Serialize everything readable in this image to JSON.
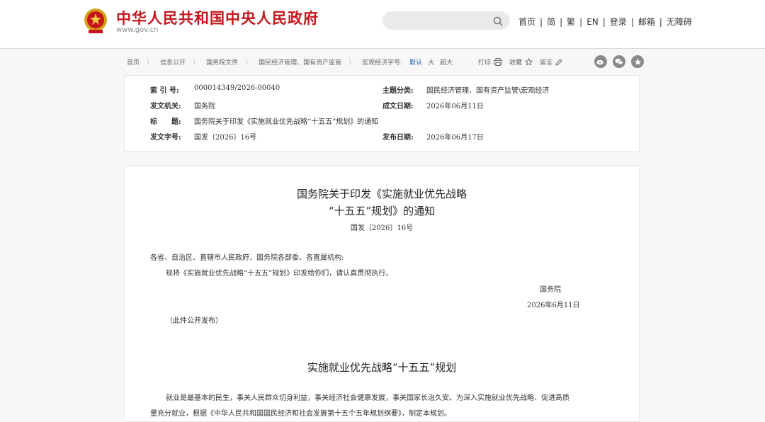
{
  "header": {
    "site_title": "中华人民共和国中央人民政府",
    "site_domain": "www.gov.cn",
    "search_placeholder": "",
    "links": [
      "首页",
      "简",
      "繁",
      "EN",
      "登录",
      "邮箱",
      "无障碍"
    ],
    "separator": "|"
  },
  "breadcrumb": {
    "items": [
      "首页",
      "信息公开",
      "国务院文件",
      "国民经济管理、国有资产监管",
      "宏观经济字号:"
    ],
    "arrow": "〉",
    "font_sizes": [
      "默认",
      "大",
      "超大"
    ],
    "active_font_size": "默认"
  },
  "actions": {
    "print": "打印",
    "favorite": "收藏",
    "comment": "留言"
  },
  "share": [
    "weibo-icon",
    "wechat-icon",
    "star-icon"
  ],
  "meta": {
    "index_label": "索 引 号:",
    "index_value": "000014349/2026-00040",
    "category_label": "主题分类:",
    "category_value": "国民经济管理、国有资产监管\\宏观经济",
    "issuer_label": "发文机关:",
    "issuer_value": "国务院",
    "created_label": "成文日期:",
    "created_value": "2026年06月11日",
    "title_label": "标　　题:",
    "title_value": "国务院关于印发《实施就业优先战略“十五五”规划》的通知",
    "docno_label": "发文字号:",
    "docno_value": "国发〔2026〕16号",
    "published_label": "发布日期:",
    "published_value": "2026年06月17日"
  },
  "article": {
    "title_line1": "国务院关于印发《实施就业优先战略",
    "title_line2": "“十五五”规划》的通知",
    "doc_number": "国发〔2026〕16号",
    "salutation": "各省、自治区、直辖市人民政府，国务院各部委、各直属机构:",
    "body": "现将《实施就业优先战略“十五五”规划》印发给你们，请认真贯彻执行。",
    "signatory": "国务院",
    "date": "2026年6月11日",
    "note": "（此件公开发布）",
    "plan_title": "实施就业优先战略“十五五”规划",
    "plan_para_line1": "就业是最基本的民生，事关人民群众切身利益，事关经济社会健康发展，事关国家长治久安。为深入实施就业优先战略、促进高质",
    "plan_para_line2": "量充分就业，根据《中华人民共和国国民经济和社会发展第十五个五年规划纲要》，制定本规划。"
  },
  "colors": {
    "brand_red": "#c4161c",
    "link_blue": "#1f5ea8"
  }
}
